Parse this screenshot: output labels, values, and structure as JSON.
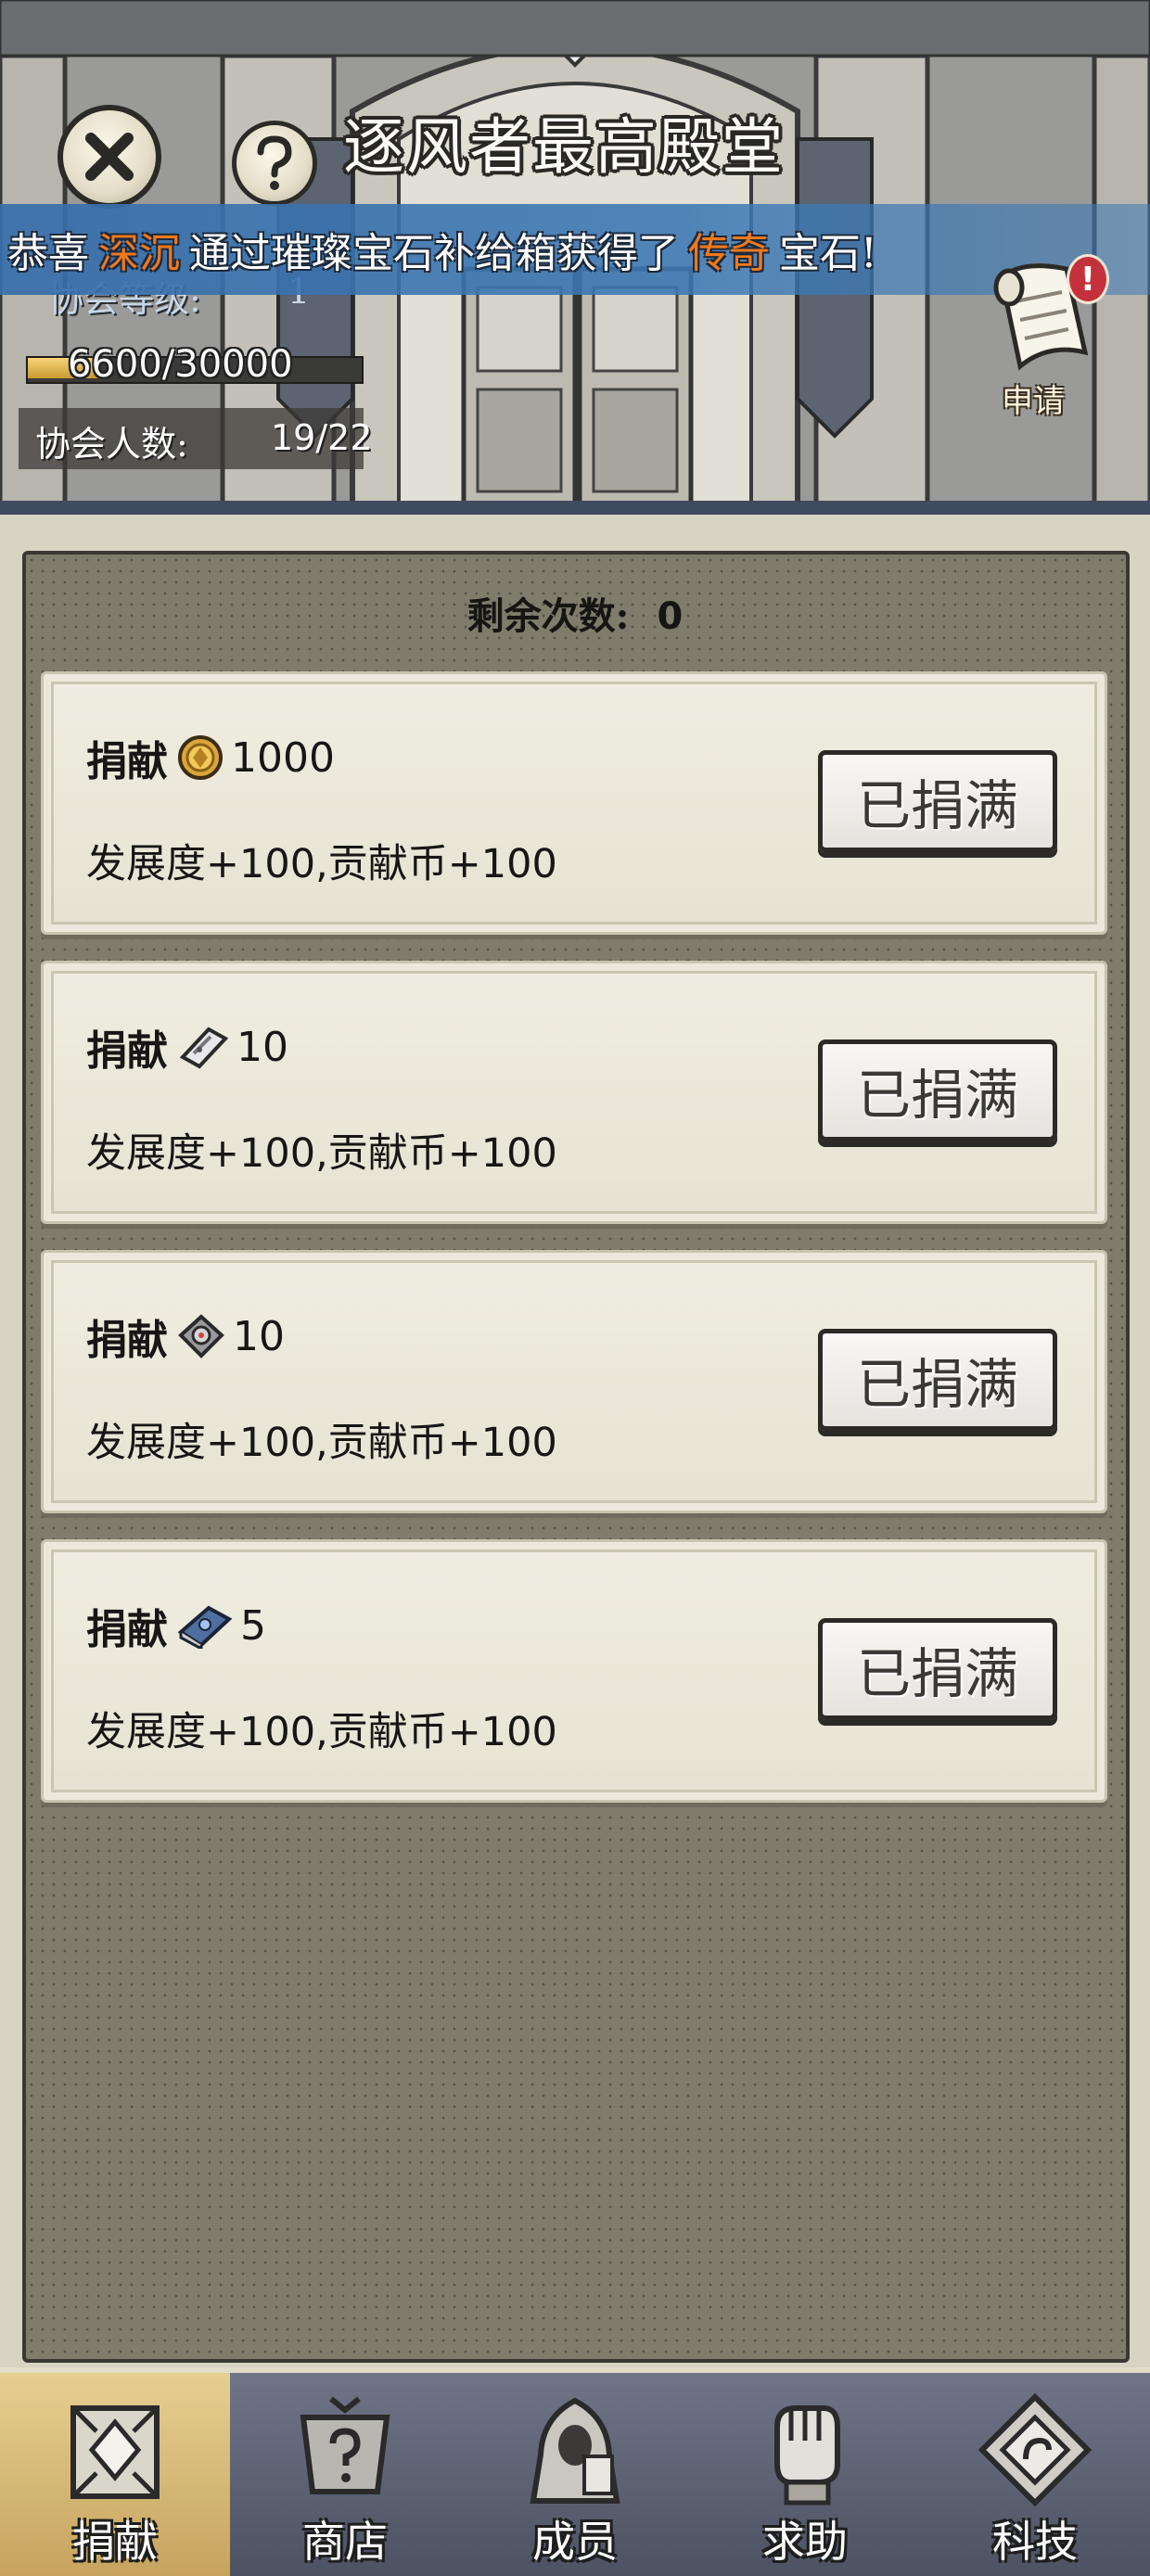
{
  "header": {
    "title": "逐风者最高殿堂",
    "close_icon": "close-icon",
    "help_icon": "question-icon"
  },
  "ticker": {
    "prefix": "恭喜",
    "player": "深沉",
    "middle": "通过璀璨宝石补给箱获得了",
    "rarity": "传奇",
    "suffix": "宝石!",
    "highlight_color": "#f0791c"
  },
  "guild": {
    "level_label": "协会等级:",
    "level_value": "1",
    "xp_text": "6600/30000",
    "xp_fraction": 0.22,
    "member_label": "协会人数:",
    "member_value": "19/22"
  },
  "apply": {
    "label": "申请",
    "badge": "!"
  },
  "donate": {
    "remaining_label": "剩余次数:",
    "remaining_value": "0",
    "items": [
      {
        "action": "捐献",
        "icon": "gold-coin-icon",
        "amount": "1000",
        "reward_dev": "发展度",
        "reward_dev_value": "+100,",
        "reward_coin": "贡献币",
        "reward_coin_value": "+100",
        "button": "已捐满"
      },
      {
        "action": "捐献",
        "icon": "scroll-ticket-icon",
        "amount": "10",
        "reward_dev": "发展度",
        "reward_dev_value": "+100,",
        "reward_coin": "贡献币",
        "reward_coin_value": "+100",
        "button": "已捐满"
      },
      {
        "action": "捐献",
        "icon": "gear-stone-icon",
        "amount": "10",
        "reward_dev": "发展度",
        "reward_dev_value": "+100,",
        "reward_coin": "贡献币",
        "reward_coin_value": "+100",
        "button": "已捐满"
      },
      {
        "action": "捐献",
        "icon": "spellbook-icon",
        "amount": "5",
        "reward_dev": "发展度",
        "reward_dev_value": "+100,",
        "reward_coin": "贡献币",
        "reward_coin_value": "+100",
        "button": "已捐满"
      }
    ]
  },
  "nav": {
    "active": 0,
    "items": [
      {
        "label": "捐献",
        "icon": "donate-box-icon"
      },
      {
        "label": "商店",
        "icon": "shop-sign-icon"
      },
      {
        "label": "成员",
        "icon": "hooded-figure-icon"
      },
      {
        "label": "求助",
        "icon": "raised-fist-icon"
      },
      {
        "label": "科技",
        "icon": "tech-diamond-icon"
      }
    ]
  }
}
